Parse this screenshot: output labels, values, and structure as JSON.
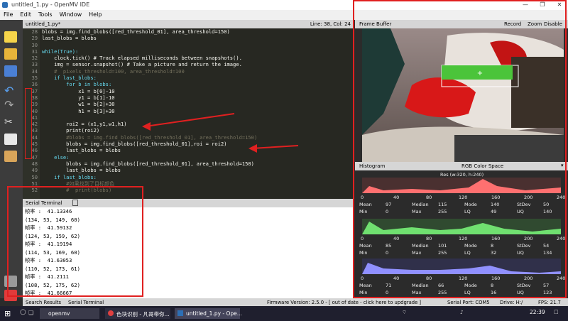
{
  "window": {
    "title": "untitled_1.py - OpenMV IDE",
    "controls": [
      "—",
      "❐",
      "✕"
    ]
  },
  "menu": [
    "File",
    "Edit",
    "Tools",
    "Window",
    "Help"
  ],
  "editor": {
    "file_tab": "untitled_1.py*",
    "position": "Line: 38, Col: 24",
    "line_numbers": [
      "28",
      "29",
      "30",
      "31",
      "32",
      "33",
      "34",
      "35",
      "36",
      "37",
      "38",
      "39",
      "40",
      "41",
      "42",
      "43",
      "44",
      "45",
      "46",
      "47",
      "48",
      "49",
      "50",
      "51",
      "52"
    ],
    "lines": [
      "blobs = img.find_blobs([red_threshold_01], area_threshold=150)",
      "last_blobs = blobs",
      "",
      "while(True):",
      "    clock.tick() # Track elapsed milliseconds between snapshots().",
      "    img = sensor.snapshot() # Take a picture and return the image.",
      "    #  pixels_threshold=100, area_threshold=100",
      "    if last_blobs:",
      "        for b in blobs:",
      "            x1 = b[0]-10",
      "            y1 = b[1]-10",
      "            w1 = b[2]+30",
      "            h1 = b[3]+30",
      "",
      "        roi2 = (x1,y1,w1,h1)",
      "        print(roi2)",
      "        #blobs = img.find_blobs([red_threshold_01], area_threshold=150)",
      "        blobs = img.find_blobs([red_threshold_01],roi = roi2)",
      "        last_blobs = blobs",
      "    else:",
      "        blobs = img.find_blobs([red_threshold_01], area_threshold=150)",
      "        last_blobs = blobs",
      "    if last_blobs:",
      "        #如果找到了目标颜色",
      "        #  print(blobs)"
    ]
  },
  "serial": {
    "tabs": [
      "Serial Terminal"
    ],
    "lines": [
      "帧率 :  41.13346",
      "(134, 53, 149, 60)",
      "帧率 :  41.59132",
      "(124, 53, 159, 62)",
      "帧率 :  41.19194",
      "(114, 53, 169, 60)",
      "帧率 :  41.63053",
      "(110, 52, 173, 61)",
      "帧率 :  41.2111",
      "(108, 52, 175, 62)",
      "帧率 :  41.66667"
    ]
  },
  "bottom_tabs": [
    "Search Results",
    "Serial Terminal"
  ],
  "framebuffer": {
    "title": "Frame Buffer",
    "buttons": [
      "Record",
      "Zoom",
      "Disable"
    ]
  },
  "histogram": {
    "title": "Histogram",
    "colorspace": "RGB Color Space",
    "resolution": "Res (w:320, h:240)",
    "axis": [
      "0",
      "40",
      "80",
      "120",
      "160",
      "200",
      "240"
    ],
    "stats": [
      {
        "color": "#ff6060",
        "r1": [
          "Mean",
          "97",
          "Median",
          "115",
          "Mode",
          "140",
          "StDev",
          "50"
        ],
        "r2": [
          "Min",
          "0",
          "Max",
          "255",
          "LQ",
          "49",
          "UQ",
          "140"
        ]
      },
      {
        "color": "#60e060",
        "r1": [
          "Mean",
          "85",
          "Median",
          "101",
          "Mode",
          "8",
          "StDev",
          "54"
        ],
        "r2": [
          "Min",
          "0",
          "Max",
          "255",
          "LQ",
          "32",
          "UQ",
          "134"
        ]
      },
      {
        "color": "#8080ff",
        "r1": [
          "Mean",
          "71",
          "Median",
          "66",
          "Mode",
          "8",
          "StDev",
          "57"
        ],
        "r2": [
          "Min",
          "0",
          "Max",
          "255",
          "LQ",
          "16",
          "UQ",
          "123"
        ]
      }
    ]
  },
  "statusbar": {
    "firmware": "Firmware Version: 2.5.0 - [ out of date - click here to updgrade ]",
    "serial_port": "Serial Port: COM5",
    "drive": "Drive: H:/",
    "fps": "FPS:  21.7"
  },
  "taskbar": {
    "search": "openmv",
    "apps": [
      "色块识别 - 凡哥带你...",
      "untitled_1.py - Ope..."
    ],
    "time": "22:39"
  }
}
